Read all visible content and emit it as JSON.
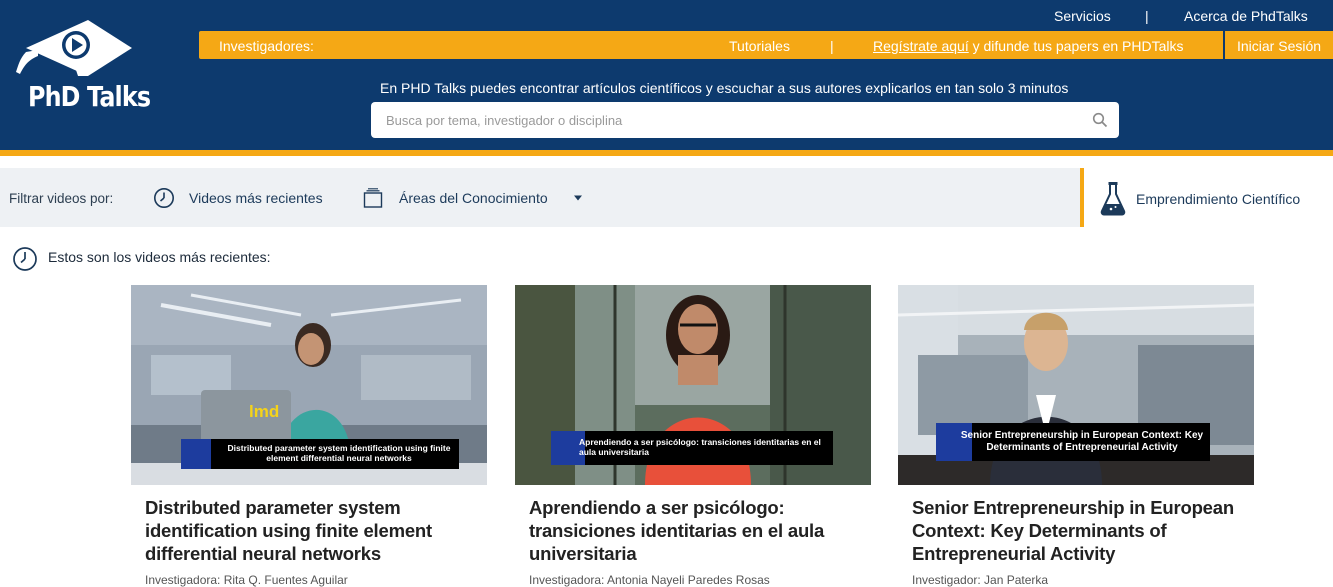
{
  "header": {
    "brand": "PhD Talks",
    "top_links": {
      "servicios": "Servicios",
      "separator": "|",
      "acerca": "Acerca de PhdTalks"
    },
    "orange_bar": {
      "label": "Investigadores:",
      "tutoriales": "Tutoriales",
      "separator": "|",
      "register_link": "Regístrate aquí",
      "register_rest": " y difunde tus papers en PHDTalks",
      "login": "Iniciar Sesión"
    },
    "tagline": "En PHD Talks puedes encontrar artículos científicos y escuchar a sus autores explicarlos en tan solo 3 minutos",
    "search": {
      "placeholder": "Busca por tema, investigador o disciplina",
      "value": ""
    }
  },
  "filters": {
    "label": "Filtrar videos por:",
    "recent": "Videos más recientes",
    "areas": "Áreas del Conocimiento",
    "entrepreneurship": "Emprendimiento Científico"
  },
  "section_title": "Estos son los videos más recientes:",
  "cards": [
    {
      "thumb_caption": "Distributed parameter system identification using finite element differential neural networks",
      "thumb_brand": "lmd",
      "title": "Distributed parameter system identification using finite element differential neural networks",
      "author": "Investigadora: Rita Q. Fuentes Aguilar"
    },
    {
      "thumb_caption": "Aprendiendo a ser psicólogo: transiciones identitarias en el aula universitaria",
      "title": "Aprendiendo a ser psicólogo: transiciones identitarias en el aula universitaria",
      "author": "Investigadora: Antonia Nayeli Paredes Rosas"
    },
    {
      "thumb_caption": "Senior Entrepreneurship in European Context: Key Determinants of Entrepreneurial Activity",
      "title": "Senior Entrepreneurship in European Context: Key Determinants of Entrepreneurial Activity",
      "author": "Investigador: Jan Paterka"
    }
  ],
  "colors": {
    "navy": "#0d3a6e",
    "orange": "#f5a815",
    "filter_bg": "#eef1f4"
  },
  "icons": [
    "play-logo-icon",
    "search-icon",
    "clock-icon",
    "folder-icon",
    "caret-down-icon",
    "flask-icon"
  ]
}
